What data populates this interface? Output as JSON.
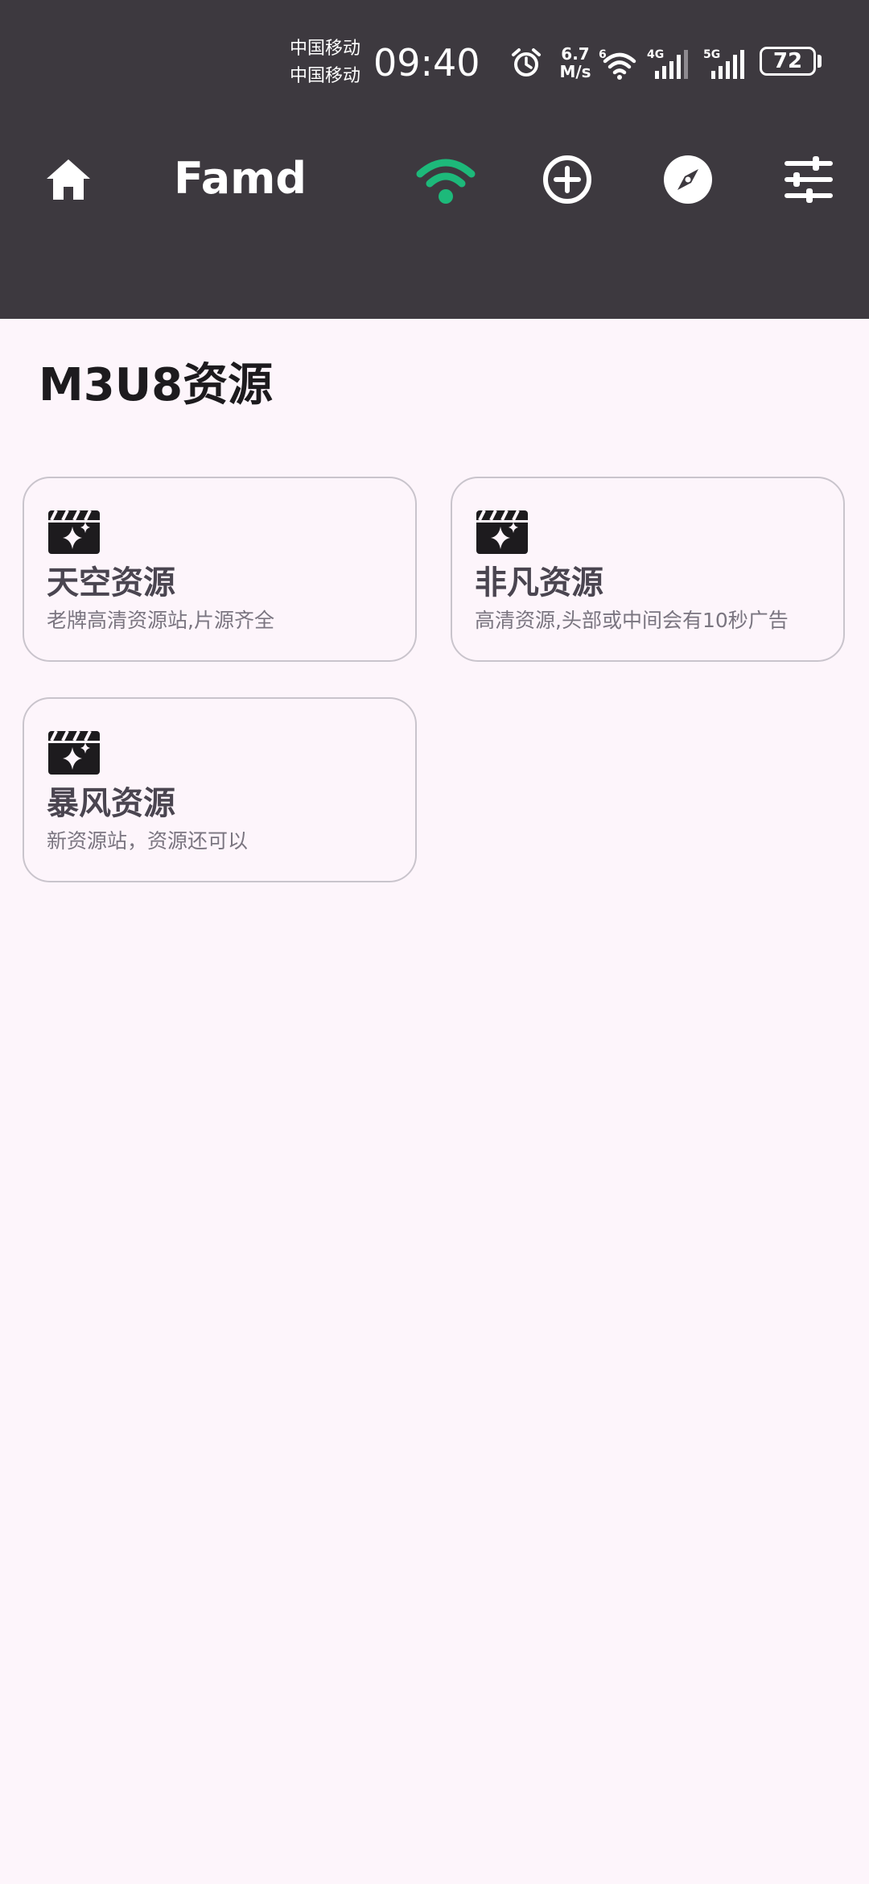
{
  "status_bar": {
    "carrier_1": "中国移动",
    "carrier_2": "中国移动",
    "time": "09:40",
    "net_speed_value": "6.7",
    "net_speed_unit": "M/s",
    "wifi_badge": "6",
    "signal_1_label": "4G",
    "signal_2_label": "5G",
    "battery": "72",
    "icons": [
      "alarm-icon",
      "wifi-icon",
      "cell-signal-icon",
      "cell-signal-icon",
      "battery-icon"
    ]
  },
  "app_bar": {
    "title": "Famd",
    "icons": [
      "home-icon",
      "wifi-icon",
      "add-circle-icon",
      "compass-icon",
      "sliders-icon"
    ],
    "wifi_color": "#1DB97A",
    "background": "#3D393F"
  },
  "page": {
    "section_title": "M3U8资源",
    "cards": [
      {
        "title": "天空资源",
        "description": "老牌高清资源站,片源齐全",
        "icon": "movie-clapper-sparkle-icon"
      },
      {
        "title": "非凡资源",
        "description": "高清资源,头部或中间会有10秒广告",
        "icon": "movie-clapper-sparkle-icon"
      },
      {
        "title": "暴风资源",
        "description": "新资源站，资源还可以",
        "icon": "movie-clapper-sparkle-icon"
      }
    ]
  }
}
